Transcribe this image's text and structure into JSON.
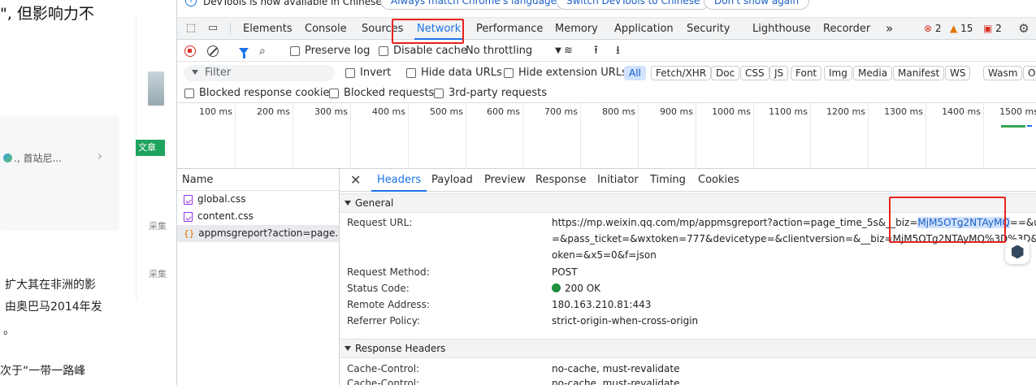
{
  "page": {
    "snippet_top": "\", 但影响力不",
    "card_text": "., 首站尼...",
    "tag": "文章",
    "side_label_1": "采集",
    "side_label_2": "采集",
    "para_1": "扩大其在非洲的影",
    "para_2": "由奥巴马2014年发",
    "para_3": "。",
    "para_4": "次于“一带一路峰"
  },
  "infobar": {
    "text": "DevTools is now available in Chinese!",
    "btn_match": "Always match Chrome's language",
    "btn_switch": "Switch DevTools to Chinese",
    "btn_dont": "Don't show again"
  },
  "tabs": {
    "items": [
      "Elements",
      "Console",
      "Sources",
      "Network",
      "Performance",
      "Memory",
      "Application",
      "Security",
      "Lighthouse",
      "Recorder"
    ],
    "active": "Network",
    "more": "»",
    "errors": "2",
    "warnings": "15",
    "issues": "2"
  },
  "toolbar": {
    "preserve_log": "Preserve log",
    "disable_cache": "Disable cache",
    "throttling": "No throttling"
  },
  "filter": {
    "placeholder": "Filter",
    "invert": "Invert",
    "hide_data_urls": "Hide data URLs",
    "hide_extension_urls": "Hide extension URLs",
    "types": [
      "All",
      "Fetch/XHR",
      "Doc",
      "CSS",
      "JS",
      "Font",
      "Img",
      "Media",
      "Manifest",
      "WS",
      "Wasm",
      "Other"
    ],
    "active_type": "All"
  },
  "blocked": {
    "cookies": "Blocked response cookies",
    "requests": "Blocked requests",
    "third_party": "3rd-party requests"
  },
  "timeline": {
    "ticks": [
      "100 ms",
      "200 ms",
      "300 ms",
      "400 ms",
      "500 ms",
      "600 ms",
      "700 ms",
      "800 ms",
      "900 ms",
      "1000 ms",
      "1100 ms",
      "1200 ms",
      "1300 ms",
      "1400 ms",
      "1500 ms"
    ]
  },
  "requests": {
    "header": "Name",
    "rows": [
      {
        "name": "global.css",
        "type": "css"
      },
      {
        "name": "content.css",
        "type": "css"
      },
      {
        "name": "appmsgreport?action=page...",
        "type": "xhr"
      }
    ]
  },
  "detail": {
    "tabs": [
      "Headers",
      "Payload",
      "Preview",
      "Response",
      "Initiator",
      "Timing",
      "Cookies"
    ],
    "active_tab": "Headers",
    "general_title": "General",
    "request_url_key": "Request URL:",
    "url_line1_pre": "https://mp.weixin.qq.com/mp/appmsgreport?action=page_time_5s&__biz=",
    "url_line1_hl": "MjM5OTg2NTAyMQ",
    "url_line1_post": "==&uin=",
    "url_line2": "=&pass_ticket=&wxtoken=777&devicetype=&clientversion=&__biz=MjM5OTg2NTAyMQ%3D%3D&",
    "url_line3": "oken=&x5=0&f=json",
    "method_key": "Request Method:",
    "method": "POST",
    "status_key": "Status Code:",
    "status": "200 OK",
    "remote_key": "Remote Address:",
    "remote": "180.163.210.81:443",
    "referrer_key": "Referrer Policy:",
    "referrer": "strict-origin-when-cross-origin",
    "response_headers_title": "Response Headers",
    "cache_key_1": "Cache-Control:",
    "cache_val_1": "no-cache, must-revalidate",
    "cache_key_2": "Cache-Control:",
    "cache_val_2": "no-cache, must-revalidate"
  },
  "colors": {
    "accent": "#1a73e8",
    "annotation": "#e8221b",
    "status_ok": "#1e8e3e"
  }
}
